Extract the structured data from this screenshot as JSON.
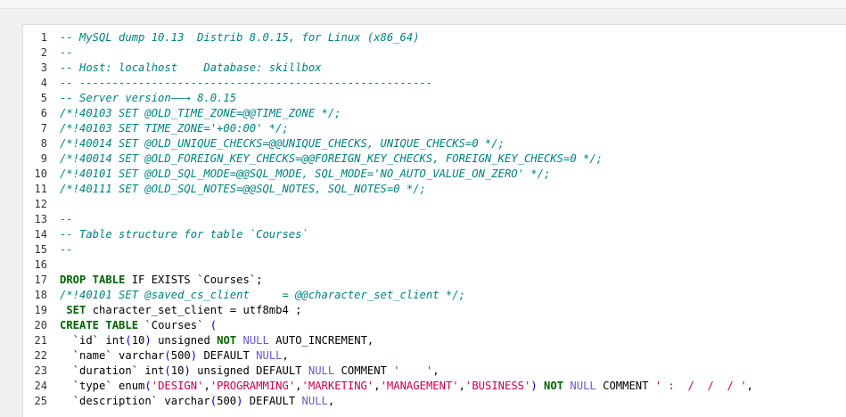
{
  "editor": {
    "lines": [
      [
        {
          "t": "comment",
          "v": "-- MySQL dump 10.13  Distrib 8.0.15, for Linux (x86_64)"
        }
      ],
      [
        {
          "t": "comment",
          "v": "--"
        }
      ],
      [
        {
          "t": "comment",
          "v": "-- Host: localhost    Database: skillbox"
        }
      ],
      [
        {
          "t": "comment",
          "v": "-- ------------------------------------------------------"
        }
      ],
      [
        {
          "t": "comment",
          "v": "-- Server version——→ 8.0.15"
        }
      ],
      [
        {
          "t": "comment",
          "v": "/*!40103 SET @OLD_TIME_ZONE=@@TIME_ZONE */;"
        }
      ],
      [
        {
          "t": "comment",
          "v": "/*!40103 SET TIME_ZONE='+00:00' */;"
        }
      ],
      [
        {
          "t": "comment",
          "v": "/*!40014 SET @OLD_UNIQUE_CHECKS=@@UNIQUE_CHECKS, UNIQUE_CHECKS=0 */;"
        }
      ],
      [
        {
          "t": "comment",
          "v": "/*!40014 SET @OLD_FOREIGN_KEY_CHECKS=@@FOREIGN_KEY_CHECKS, FOREIGN_KEY_CHECKS=0 */;"
        }
      ],
      [
        {
          "t": "comment",
          "v": "/*!40101 SET @OLD_SQL_MODE=@@SQL_MODE, SQL_MODE='NO_AUTO_VALUE_ON_ZERO' */;"
        }
      ],
      [
        {
          "t": "comment",
          "v": "/*!40111 SET @OLD_SQL_NOTES=@@SQL_NOTES, SQL_NOTES=0 */;"
        }
      ],
      [],
      [
        {
          "t": "comment",
          "v": "--"
        }
      ],
      [
        {
          "t": "comment",
          "v": "-- Table structure for table `Courses`"
        }
      ],
      [
        {
          "t": "comment",
          "v": "--"
        }
      ],
      [],
      [
        {
          "t": "kw",
          "v": "DROP TABLE"
        },
        {
          "t": "plain",
          "v": " IF EXISTS `Courses`;"
        }
      ],
      [
        {
          "t": "comment",
          "v": "/*!40101 SET @saved_cs_client     = @@character_set_client */;"
        }
      ],
      [
        {
          "t": "plain",
          "v": " "
        },
        {
          "t": "kw",
          "v": "SET"
        },
        {
          "t": "plain",
          "v": " character_set_client = utf8mb4 ;"
        }
      ],
      [
        {
          "t": "kw",
          "v": "CREATE TABLE"
        },
        {
          "t": "plain",
          "v": " `Courses` "
        },
        {
          "t": "paren",
          "v": "("
        }
      ],
      [
        {
          "t": "plain",
          "v": "  `id` int"
        },
        {
          "t": "paren",
          "v": "("
        },
        {
          "t": "plain",
          "v": "10"
        },
        {
          "t": "paren",
          "v": ")"
        },
        {
          "t": "plain",
          "v": " unsigned "
        },
        {
          "t": "kw",
          "v": "NOT"
        },
        {
          "t": "plain",
          "v": " "
        },
        {
          "t": "null",
          "v": "NULL"
        },
        {
          "t": "plain",
          "v": " AUTO_INCREMENT,"
        }
      ],
      [
        {
          "t": "plain",
          "v": "  `name` varchar"
        },
        {
          "t": "paren",
          "v": "("
        },
        {
          "t": "plain",
          "v": "500"
        },
        {
          "t": "paren",
          "v": ")"
        },
        {
          "t": "plain",
          "v": " DEFAULT "
        },
        {
          "t": "null",
          "v": "NULL"
        },
        {
          "t": "plain",
          "v": ","
        }
      ],
      [
        {
          "t": "plain",
          "v": "  `duration` int"
        },
        {
          "t": "paren",
          "v": "("
        },
        {
          "t": "plain",
          "v": "10"
        },
        {
          "t": "paren",
          "v": ")"
        },
        {
          "t": "plain",
          "v": " unsigned DEFAULT "
        },
        {
          "t": "null",
          "v": "NULL"
        },
        {
          "t": "plain",
          "v": " COMMENT "
        },
        {
          "t": "str",
          "v": "'    '"
        },
        {
          "t": "plain",
          "v": ","
        }
      ],
      [
        {
          "t": "plain",
          "v": "  `type` enum"
        },
        {
          "t": "paren",
          "v": "("
        },
        {
          "t": "str",
          "v": "'DESIGN'"
        },
        {
          "t": "plain",
          "v": ","
        },
        {
          "t": "str",
          "v": "'PROGRAMMING'"
        },
        {
          "t": "plain",
          "v": ","
        },
        {
          "t": "str",
          "v": "'MARKETING'"
        },
        {
          "t": "plain",
          "v": ","
        },
        {
          "t": "str",
          "v": "'MANAGEMENT'"
        },
        {
          "t": "plain",
          "v": ","
        },
        {
          "t": "str",
          "v": "'BUSINESS'"
        },
        {
          "t": "paren",
          "v": ")"
        },
        {
          "t": "plain",
          "v": " "
        },
        {
          "t": "kw",
          "v": "NOT"
        },
        {
          "t": "plain",
          "v": " "
        },
        {
          "t": "null",
          "v": "NULL"
        },
        {
          "t": "plain",
          "v": " COMMENT "
        },
        {
          "t": "str",
          "v": "' :  /  /  / '"
        },
        {
          "t": "plain",
          "v": ","
        }
      ],
      [
        {
          "t": "plain",
          "v": "  `description` varchar"
        },
        {
          "t": "paren",
          "v": "("
        },
        {
          "t": "plain",
          "v": "500"
        },
        {
          "t": "paren",
          "v": ")"
        },
        {
          "t": "plain",
          "v": " DEFAULT "
        },
        {
          "t": "null",
          "v": "NULL"
        },
        {
          "t": "plain",
          "v": ","
        }
      ]
    ]
  }
}
